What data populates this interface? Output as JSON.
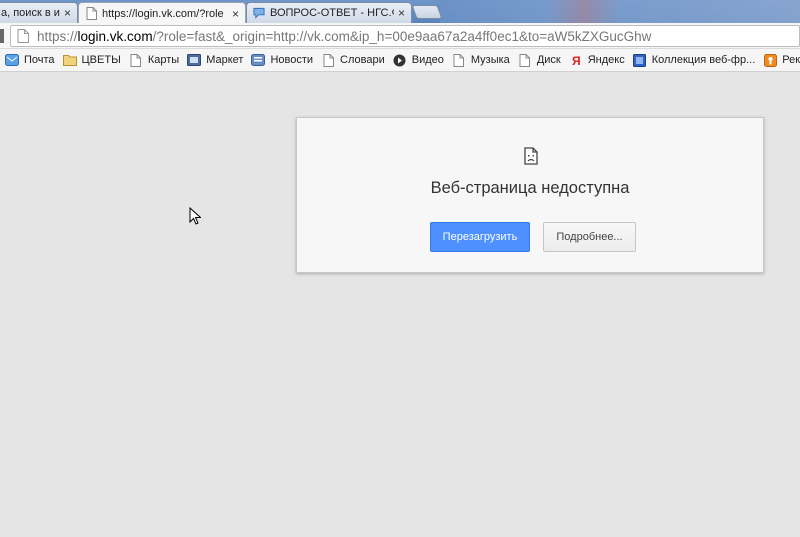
{
  "tabs": [
    {
      "title": "а, поиск в ин",
      "close": "×",
      "active": false
    },
    {
      "title": "https://login.vk.com/?role",
      "close": "×",
      "active": true
    },
    {
      "title": "ВОПРОС-ОТВЕТ - НГС.Ф",
      "close": "×",
      "active": false
    }
  ],
  "omnibox": {
    "scheme": "https://",
    "host": "login.vk.com",
    "rest": "/?role=fast&_origin=http://vk.com&ip_h=00e9aa67a2a4ff0ec1&to=aW5kZXGucGhw"
  },
  "bookmarks": [
    {
      "label": "Почта",
      "icon": "mail-icon"
    },
    {
      "label": "ЦВЕТЫ",
      "icon": "folder-icon"
    },
    {
      "label": "Карты",
      "icon": "page-icon"
    },
    {
      "label": "Маркет",
      "icon": "market-icon"
    },
    {
      "label": "Новости",
      "icon": "news-icon"
    },
    {
      "label": "Словари",
      "icon": "page-icon"
    },
    {
      "label": "Видео",
      "icon": "play-icon"
    },
    {
      "label": "Музыка",
      "icon": "page-icon"
    },
    {
      "label": "Диск",
      "icon": "page-icon"
    },
    {
      "label": "Яндекс",
      "icon": "yandex-icon"
    },
    {
      "label": "Коллекция веб-фр...",
      "icon": "collection-icon"
    },
    {
      "label": "Реком",
      "icon": "recommend-icon"
    }
  ],
  "error": {
    "title": "Веб-страница недоступна",
    "reload_label": "Перезагрузить",
    "details_label": "Подробнее..."
  },
  "colors": {
    "accent_button": "#4d90fe",
    "page_background": "#e5e5e5"
  }
}
